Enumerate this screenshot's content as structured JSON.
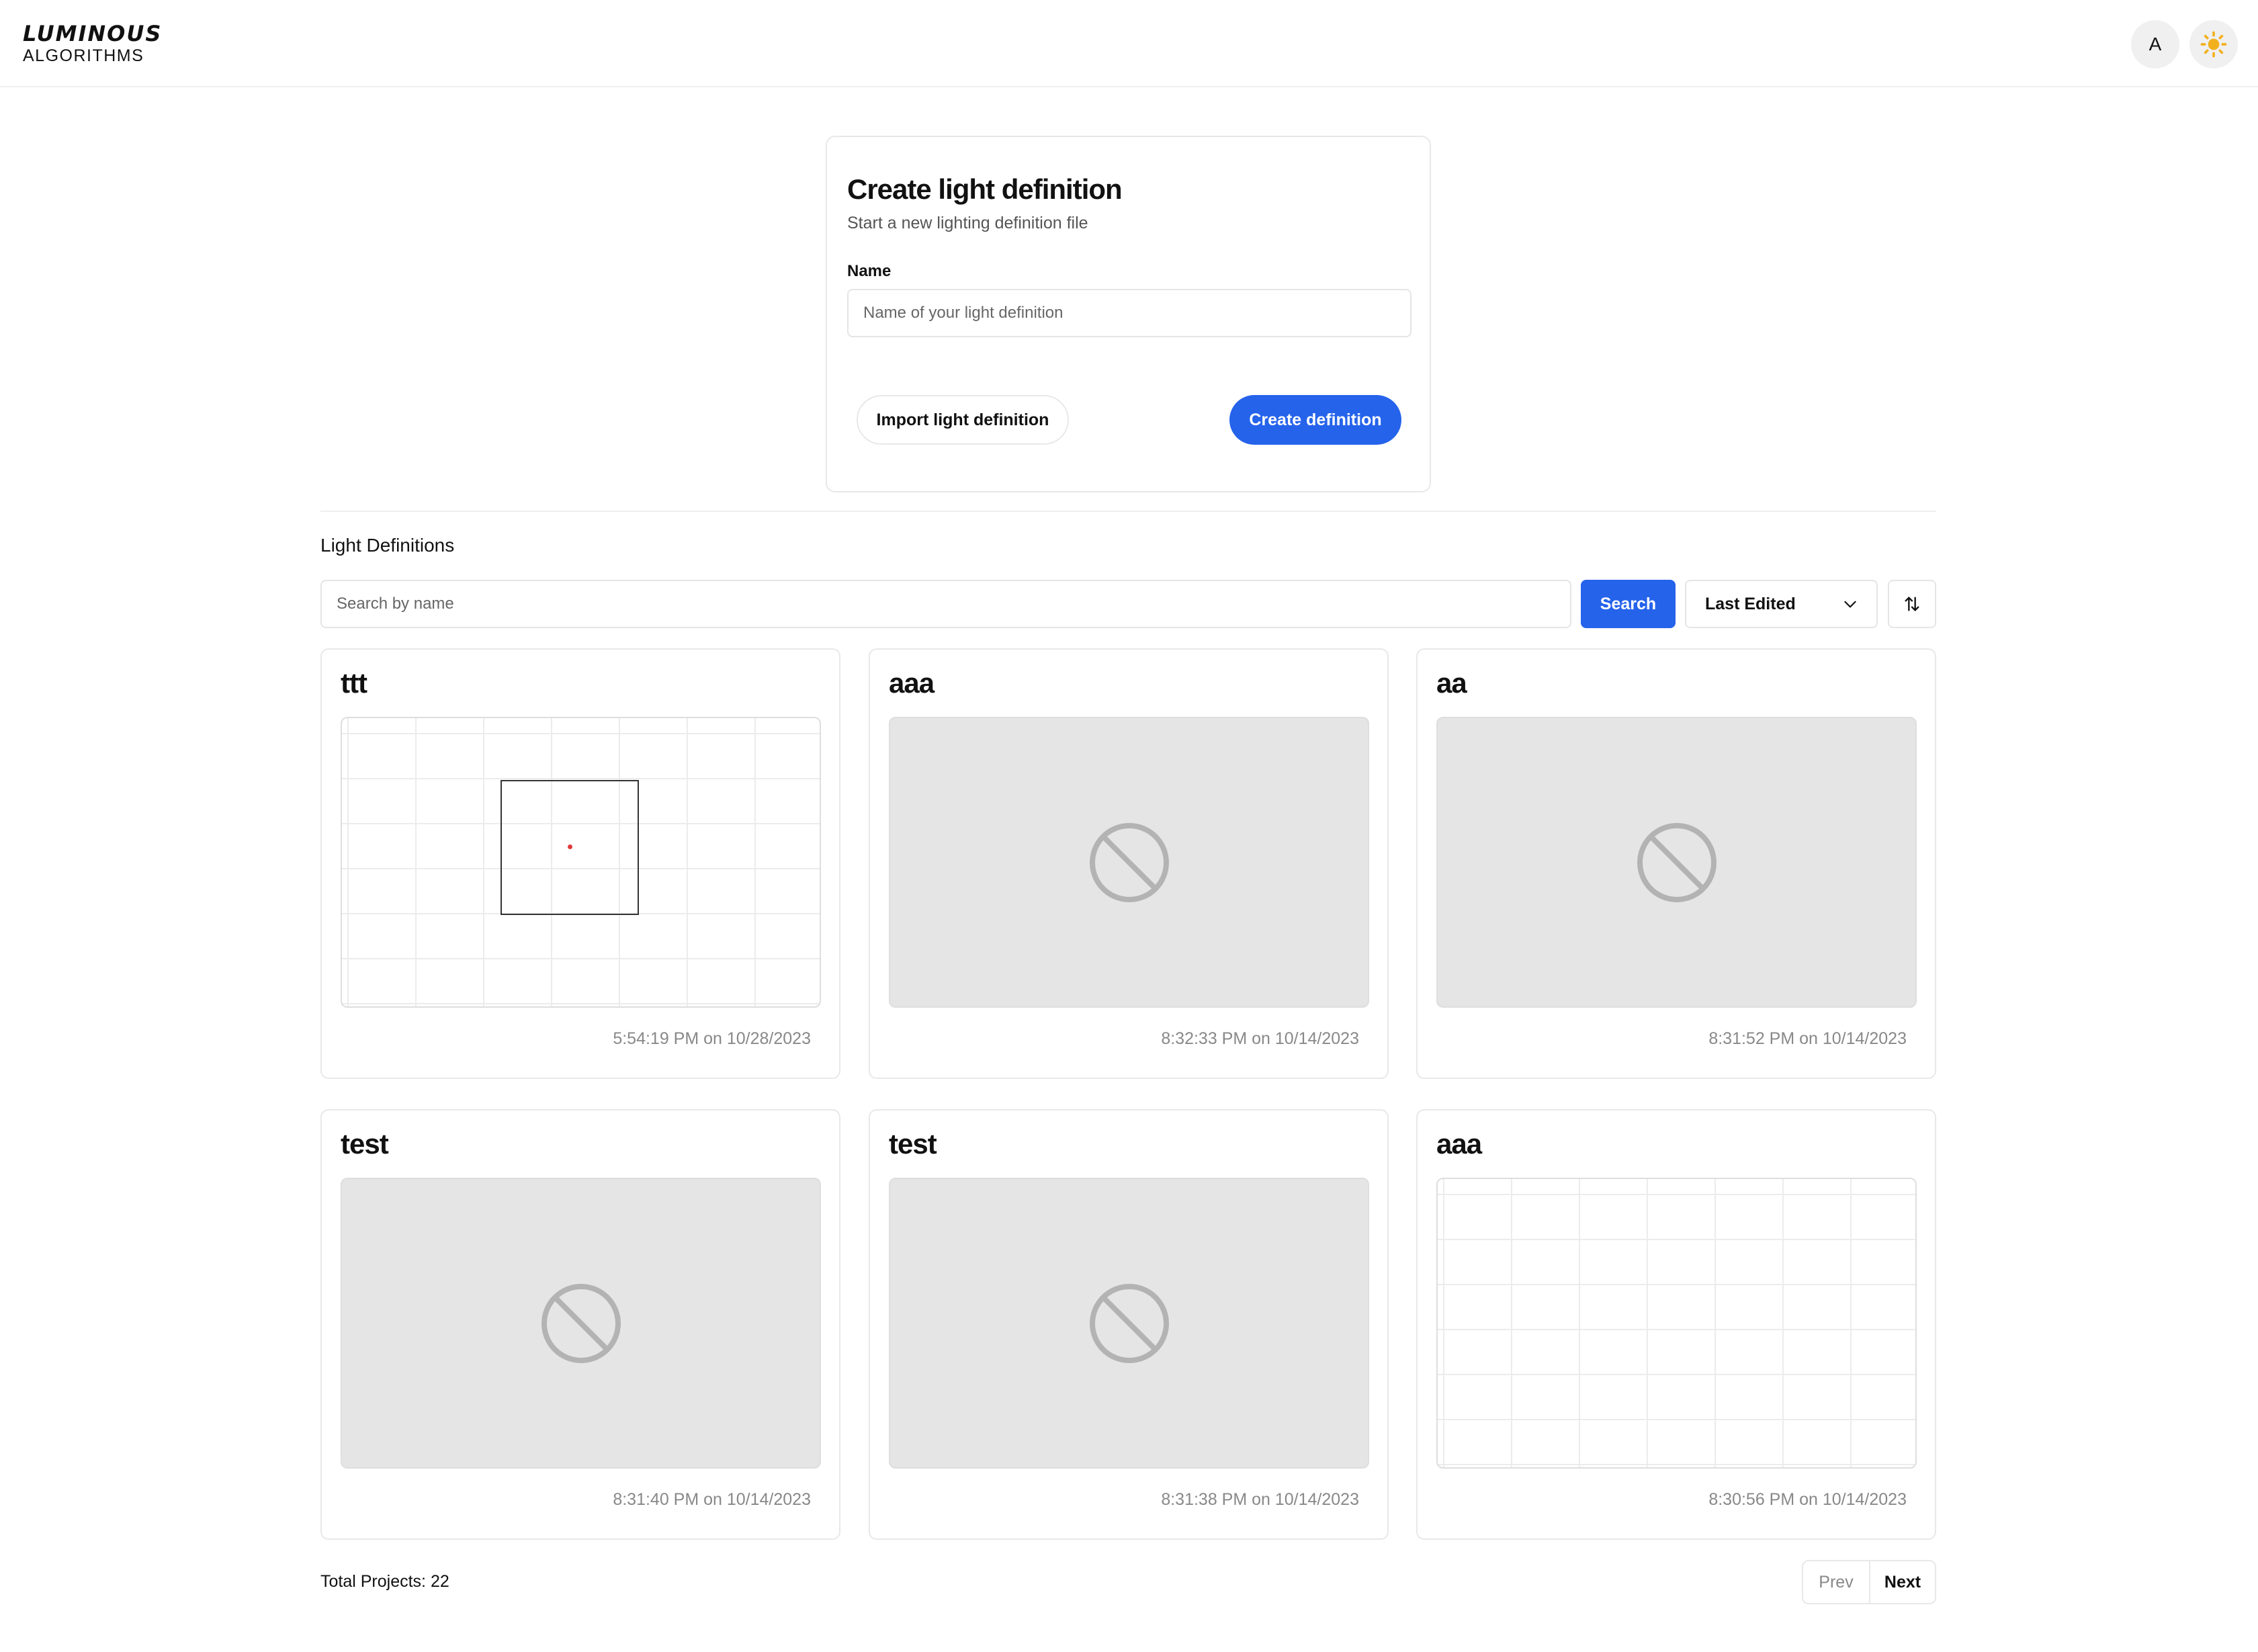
{
  "header": {
    "logo_top": "LUMINOUS",
    "logo_bottom": "ALGORITHMS",
    "avatar_initial": "A",
    "theme_icon": "sun-icon",
    "theme_icon_color": "#f2b01e"
  },
  "create_form": {
    "title": "Create light definition",
    "subtitle": "Start a new lighting definition file",
    "name_label": "Name",
    "name_placeholder": "Name of your light definition",
    "name_value": "",
    "import_button": "Import light definition",
    "create_button": "Create definition"
  },
  "list": {
    "title": "Light Definitions",
    "search_placeholder": "Search by name",
    "search_button": "Search",
    "sort_value": "Last Edited",
    "sort_direction_icon": "arrows-up-down-icon"
  },
  "cards": [
    {
      "title": "ttt",
      "date": "5:54:19 PM on 10/28/2023",
      "preview": "grid-with-frame"
    },
    {
      "title": "aaa",
      "date": "8:32:33 PM on 10/14/2023",
      "preview": "no-preview"
    },
    {
      "title": "aa",
      "date": "8:31:52 PM on 10/14/2023",
      "preview": "no-preview"
    },
    {
      "title": "test",
      "date": "8:31:40 PM on 10/14/2023",
      "preview": "no-preview"
    },
    {
      "title": "test",
      "date": "8:31:38 PM on 10/14/2023",
      "preview": "no-preview"
    },
    {
      "title": "aaa",
      "date": "8:30:56 PM on 10/14/2023",
      "preview": "grid"
    }
  ],
  "footer": {
    "total_label": "Total Projects: 22",
    "prev_label": "Prev",
    "next_label": "Next"
  },
  "colors": {
    "accent": "#2563eb",
    "preview_empty_bg": "#e5e5e5",
    "no_preview_icon": "#b3b3b3"
  }
}
